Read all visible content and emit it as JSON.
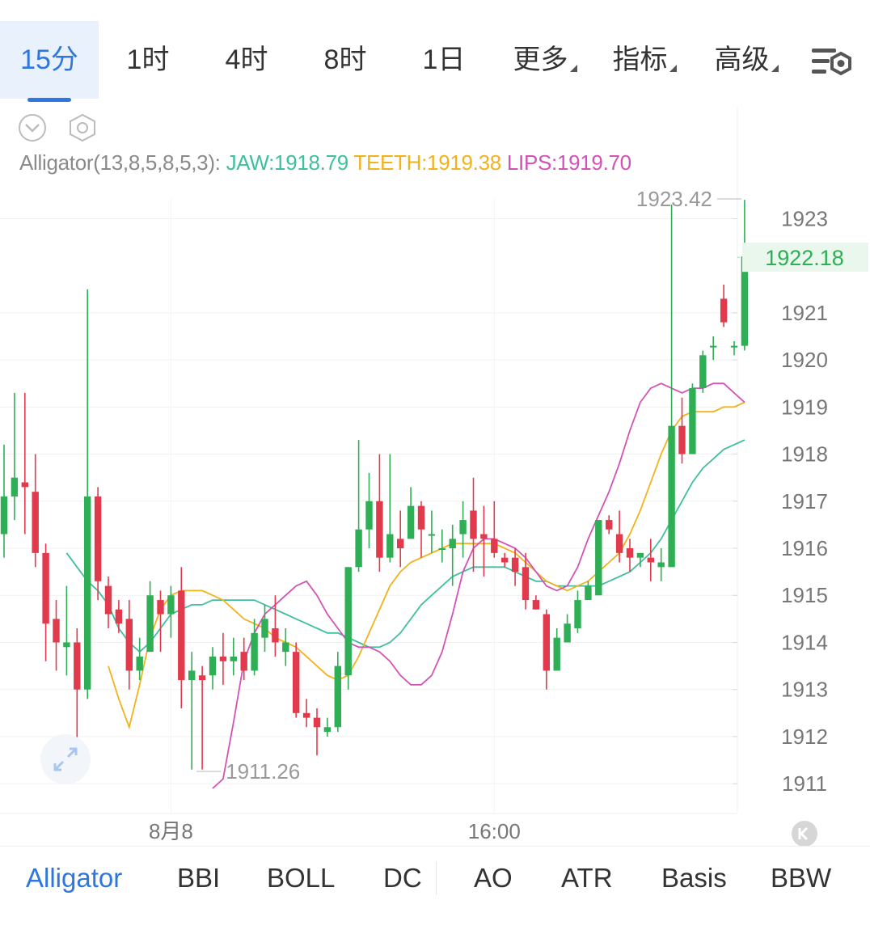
{
  "timeframes": [
    {
      "label": "15分",
      "active": true
    },
    {
      "label": "1时",
      "active": false
    },
    {
      "label": "4时",
      "active": false
    },
    {
      "label": "8时",
      "active": false
    },
    {
      "label": "1日",
      "active": false
    },
    {
      "label": "更多",
      "active": false,
      "dropdown": true
    },
    {
      "label": "指标",
      "active": false,
      "dropdown": true
    },
    {
      "label": "高级",
      "active": false,
      "dropdown": true
    }
  ],
  "indicator_readout": {
    "name": "Alligator(13,8,5,8,5,3):",
    "jaw": "JAW:1918.79",
    "teeth": "TEETH:1919.38",
    "lips": "LIPS:1919.70"
  },
  "indicator_tabs": [
    {
      "label": "Alligator",
      "active": true
    },
    {
      "label": "BBI",
      "active": false
    },
    {
      "label": "BOLL",
      "active": false
    },
    {
      "label": "DC",
      "active": false
    },
    {
      "label": "AO",
      "active": false
    },
    {
      "label": "ATR",
      "active": false
    },
    {
      "label": "Basis",
      "active": false
    },
    {
      "label": "BBW",
      "active": false
    }
  ],
  "colors": {
    "up": "#2eaf55",
    "down": "#e23a4d",
    "jaw": "#3fbf9f",
    "teeth": "#f2b21c",
    "lips": "#d452b6",
    "accent": "#2f76dd",
    "price_tag_bg": "#e9f7ec",
    "grid": "#f1f1f1"
  },
  "icons": [
    "collapse-icon",
    "settings-hexagon-icon",
    "chart-settings-icon",
    "expand-icon",
    "scroll-to-latest-icon"
  ],
  "chart_data": {
    "type": "candlestick",
    "ylim": [
      1910.4,
      1924.1
    ],
    "y_ticks": [
      1923,
      1921,
      1920,
      1919,
      1918,
      1917,
      1916,
      1915,
      1914,
      1913,
      1912,
      1911
    ],
    "x_ticks": [
      {
        "label": "8月8",
        "index": 16
      },
      {
        "label": "16:00",
        "index": 47
      }
    ],
    "current_price": "1922.18",
    "max_marker": {
      "label": "1923.42",
      "index": 71
    },
    "min_marker": {
      "label": "1911.26",
      "index": 18
    },
    "candles": [
      [
        1916.3,
        1917.1,
        1915.8,
        1918.2
      ],
      [
        1917.1,
        1917.5,
        1916.6,
        1919.3
      ],
      [
        1917.4,
        1917.3,
        1916.3,
        1919.3
      ],
      [
        1917.2,
        1915.9,
        1915.6,
        1918.0
      ],
      [
        1915.9,
        1914.4,
        1913.6,
        1916.1
      ],
      [
        1914.5,
        1914.0,
        1913.4,
        1914.9
      ],
      [
        1913.9,
        1914.0,
        1913.3,
        1915.2
      ],
      [
        1914.0,
        1913.0,
        1911.9,
        1914.3
      ],
      [
        1913.0,
        1917.1,
        1912.8,
        1921.5
      ],
      [
        1917.1,
        1915.3,
        1914.9,
        1917.3
      ],
      [
        1915.2,
        1914.6,
        1914.3,
        1915.4
      ],
      [
        1914.7,
        1914.4,
        1914.2,
        1914.9
      ],
      [
        1914.5,
        1913.4,
        1913.0,
        1914.9
      ],
      [
        1913.4,
        1913.7,
        1913.2,
        1914.1
      ],
      [
        1913.8,
        1915.0,
        1913.8,
        1915.3
      ],
      [
        1914.9,
        1914.6,
        1913.8,
        1915.1
      ],
      [
        1914.6,
        1915.0,
        1914.1,
        1915.2
      ],
      [
        1915.1,
        1913.2,
        1912.6,
        1915.6
      ],
      [
        1913.2,
        1913.4,
        1911.3,
        1913.8
      ],
      [
        1913.3,
        1913.2,
        1911.3,
        1913.5
      ],
      [
        1913.3,
        1913.7,
        1913.0,
        1913.9
      ],
      [
        1913.7,
        1913.6,
        1913.1,
        1914.2
      ],
      [
        1913.6,
        1913.7,
        1913.3,
        1914.1
      ],
      [
        1913.8,
        1913.4,
        1913.2,
        1914.1
      ],
      [
        1913.4,
        1914.2,
        1913.3,
        1914.5
      ],
      [
        1914.1,
        1914.5,
        1913.8,
        1914.8
      ],
      [
        1914.3,
        1914.0,
        1913.7,
        1915.0
      ],
      [
        1913.8,
        1914.0,
        1913.5,
        1914.3
      ],
      [
        1913.8,
        1912.5,
        1912.4,
        1914.0
      ],
      [
        1912.5,
        1912.4,
        1912.2,
        1912.8
      ],
      [
        1912.4,
        1912.2,
        1911.6,
        1912.6
      ],
      [
        1912.1,
        1912.2,
        1912.0,
        1912.4
      ],
      [
        1912.2,
        1913.5,
        1912.1,
        1913.8
      ],
      [
        1913.3,
        1915.6,
        1913.0,
        1915.6
      ],
      [
        1915.6,
        1916.4,
        1915.5,
        1918.3
      ],
      [
        1916.4,
        1917.0,
        1916.0,
        1917.6
      ],
      [
        1917.0,
        1915.8,
        1915.5,
        1918.0
      ],
      [
        1915.8,
        1916.3,
        1915.7,
        1918.0
      ],
      [
        1916.2,
        1916.0,
        1915.6,
        1916.8
      ],
      [
        1916.2,
        1916.9,
        1916.2,
        1917.3
      ],
      [
        1916.9,
        1916.4,
        1915.8,
        1917.0
      ],
      [
        1916.3,
        1916.3,
        1915.9,
        1916.8
      ],
      [
        1916.0,
        1916.0,
        1915.7,
        1916.4
      ],
      [
        1916.0,
        1916.2,
        1915.2,
        1916.5
      ],
      [
        1916.3,
        1916.6,
        1915.8,
        1917.0
      ],
      [
        1916.8,
        1916.2,
        1915.5,
        1917.5
      ],
      [
        1916.3,
        1916.2,
        1915.4,
        1916.9
      ],
      [
        1916.2,
        1915.9,
        1915.8,
        1917.0
      ],
      [
        1915.8,
        1915.7,
        1915.6,
        1915.9
      ],
      [
        1915.8,
        1915.5,
        1915.2,
        1916.0
      ],
      [
        1915.6,
        1914.9,
        1914.7,
        1915.9
      ],
      [
        1914.9,
        1914.7,
        1914.7,
        1915.0
      ],
      [
        1914.6,
        1913.4,
        1913.0,
        1914.7
      ],
      [
        1913.4,
        1914.1,
        1913.4,
        1914.3
      ],
      [
        1914.0,
        1914.4,
        1914.0,
        1914.6
      ],
      [
        1914.3,
        1914.9,
        1914.2,
        1915.1
      ],
      [
        1914.9,
        1915.2,
        1914.9,
        1915.3
      ],
      [
        1915.0,
        1916.6,
        1915.0,
        1916.6
      ],
      [
        1916.6,
        1916.4,
        1916.3,
        1916.7
      ],
      [
        1916.3,
        1915.9,
        1915.7,
        1916.8
      ],
      [
        1916.0,
        1915.8,
        1915.5,
        1916.2
      ],
      [
        1915.8,
        1915.9,
        1915.6,
        1915.9
      ],
      [
        1915.8,
        1915.7,
        1915.3,
        1916.2
      ],
      [
        1915.6,
        1915.7,
        1915.3,
        1916.0
      ],
      [
        1915.6,
        1918.6,
        1915.6,
        1923.3
      ],
      [
        1918.6,
        1918.0,
        1917.8,
        1919.2
      ],
      [
        1918.0,
        1919.4,
        1918.0,
        1919.5
      ],
      [
        1919.4,
        1920.1,
        1919.3,
        1920.2
      ],
      [
        1920.3,
        1920.3,
        1920.0,
        1920.5
      ],
      [
        1921.3,
        1920.8,
        1920.7,
        1921.6
      ],
      [
        1920.3,
        1920.3,
        1920.1,
        1920.4
      ],
      [
        1920.3,
        1922.2,
        1920.2,
        1923.4
      ]
    ],
    "series": [
      {
        "name": "JAW",
        "values": [
          1915.9,
          1915.6,
          1915.3,
          1915.1,
          1914.8,
          1914.3,
          1914.0,
          1913.8,
          1914.0,
          1914.3,
          1914.6,
          1914.7,
          1914.8,
          1914.8,
          1914.9,
          1914.9,
          1914.9,
          1914.9,
          1914.9,
          1914.8,
          1914.7,
          1914.6,
          1914.5,
          1914.4,
          1914.3,
          1914.2,
          1914.2,
          1914.1,
          1914.0,
          1913.9,
          1913.9,
          1914.0,
          1914.2,
          1914.5,
          1914.8,
          1915.0,
          1915.2,
          1915.4,
          1915.5,
          1915.6,
          1915.6,
          1915.6,
          1915.6,
          1915.5,
          1915.4,
          1915.3,
          1915.3,
          1915.2,
          1915.2,
          1915.2,
          1915.2,
          1915.2,
          1915.3,
          1915.4,
          1915.5,
          1915.7,
          1915.9,
          1916.2,
          1916.6,
          1917.0,
          1917.4,
          1917.7,
          1917.9,
          1918.1,
          1918.2,
          1918.3
        ]
      },
      {
        "name": "TEETH",
        "values": [
          1913.5,
          1912.8,
          1912.2,
          1913.1,
          1914.1,
          1914.7,
          1915.0,
          1915.1,
          1915.1,
          1915.1,
          1915.0,
          1914.9,
          1914.7,
          1914.5,
          1914.4,
          1914.3,
          1914.1,
          1914.0,
          1913.9,
          1913.7,
          1913.5,
          1913.3,
          1913.2,
          1913.3,
          1913.7,
          1914.2,
          1914.7,
          1915.2,
          1915.5,
          1915.7,
          1915.8,
          1915.9,
          1916.0,
          1916.1,
          1916.1,
          1916.1,
          1916.1,
          1916.1,
          1916.0,
          1915.9,
          1915.7,
          1915.5,
          1915.3,
          1915.2,
          1915.1,
          1915.2,
          1915.3,
          1915.5,
          1915.7,
          1915.9,
          1916.3,
          1916.8,
          1917.4,
          1918.0,
          1918.5,
          1918.8,
          1918.9,
          1918.9,
          1918.9,
          1919.0,
          1919.0,
          1919.1
        ]
      },
      {
        "name": "LIPS",
        "values": [
          1910.9,
          1911.1,
          1912.3,
          1913.6,
          1914.2,
          1914.6,
          1914.8,
          1915.0,
          1915.2,
          1915.3,
          1915.0,
          1914.6,
          1914.3,
          1914.0,
          1913.9,
          1913.9,
          1913.8,
          1913.6,
          1913.3,
          1913.1,
          1913.1,
          1913.3,
          1913.8,
          1914.6,
          1915.5,
          1916.0,
          1916.2,
          1916.2,
          1916.1,
          1916.0,
          1915.8,
          1915.5,
          1915.2,
          1915.1,
          1915.2,
          1915.6,
          1916.2,
          1916.7,
          1917.2,
          1917.8,
          1918.5,
          1919.1,
          1919.4,
          1919.5,
          1919.4,
          1919.3,
          1919.4,
          1919.4,
          1919.5,
          1919.5,
          1919.3,
          1919.1
        ]
      }
    ]
  }
}
